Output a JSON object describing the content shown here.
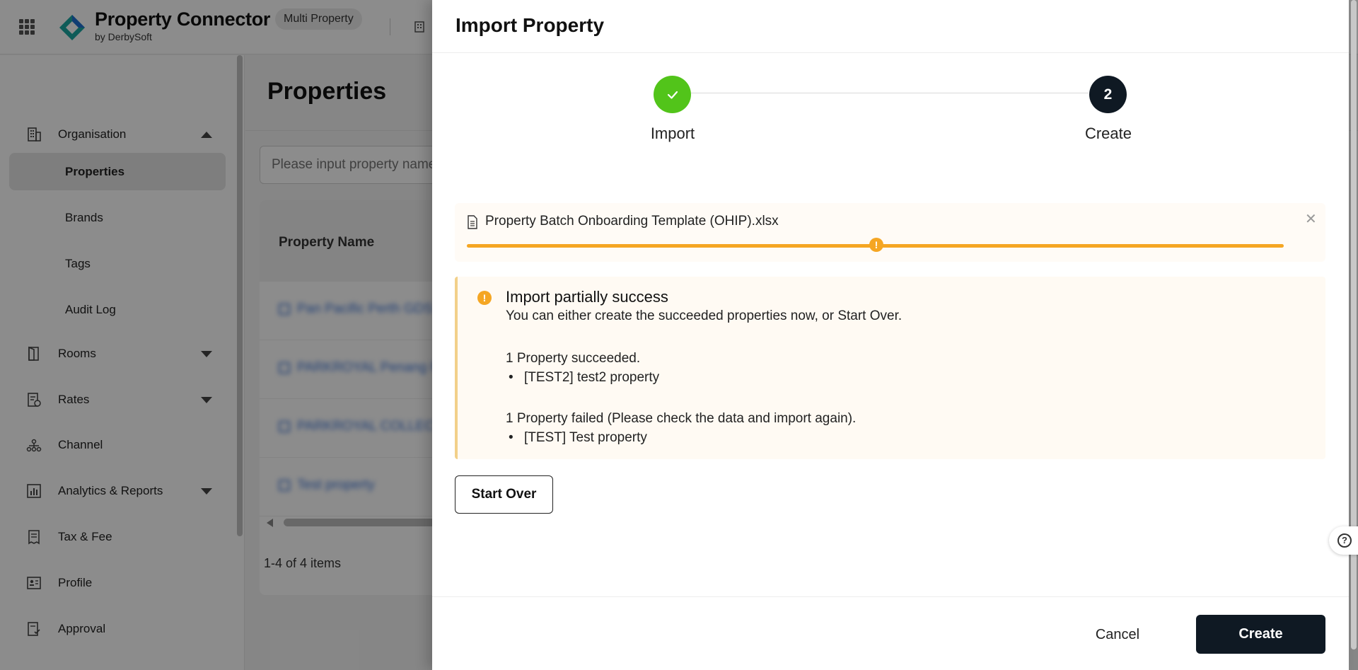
{
  "app": {
    "name": "Property Connector",
    "vendor": "by DerbySoft",
    "mode_badge": "Multi Property",
    "brand_colors": {
      "logo_teal": "#1aa6a0",
      "logo_blue": "#1f6fd1"
    }
  },
  "sidebar": {
    "organisation": {
      "label": "Organisation",
      "icon": "building-icon",
      "expanded": true
    },
    "sub_items": [
      {
        "label": "Properties",
        "active": true
      },
      {
        "label": "Brands",
        "active": false
      },
      {
        "label": "Tags",
        "active": false
      },
      {
        "label": "Audit Log",
        "active": false
      }
    ],
    "items": [
      {
        "label": "Rooms",
        "icon": "door-icon",
        "has_submenu": true
      },
      {
        "label": "Rates",
        "icon": "rate-sheet-icon",
        "has_submenu": true
      },
      {
        "label": "Channel",
        "icon": "network-icon",
        "has_submenu": false
      },
      {
        "label": "Analytics & Reports",
        "icon": "chart-icon",
        "has_submenu": true
      },
      {
        "label": "Tax & Fee",
        "icon": "receipt-icon",
        "has_submenu": false
      },
      {
        "label": "Profile",
        "icon": "profile-card-icon",
        "has_submenu": false
      },
      {
        "label": "Approval",
        "icon": "approval-icon",
        "has_submenu": false
      }
    ]
  },
  "main": {
    "title": "Properties",
    "search": {
      "placeholder": "Please input property name",
      "value": ""
    },
    "table": {
      "column_header": "Property Name",
      "rows": [
        {
          "name": "Pan Pacific Perth GDS"
        },
        {
          "name": "PARKROYAL Penang Resort"
        },
        {
          "name": "PARKROYAL COLLECTION"
        },
        {
          "name": "Test property"
        }
      ],
      "pagination": "1-4 of 4 items"
    }
  },
  "drawer": {
    "title": "Import Property",
    "steps": [
      {
        "label": "Import",
        "status": "done"
      },
      {
        "label": "Create",
        "number": "2",
        "status": "current"
      }
    ],
    "file": {
      "name": "Property Batch Onboarding Template (OHIP).xlsx",
      "progress": 1.0,
      "status": "warning",
      "status_color": "#f5a623"
    },
    "alert": {
      "title": "Import partially success",
      "description": "You can either create the succeeded properties now, or Start Over.",
      "succeeded_heading": "1 Property succeeded.",
      "succeeded_items": [
        "[TEST2] test2 property"
      ],
      "failed_heading": "1 Property failed (Please check the data and import again).",
      "failed_items": [
        "[TEST] Test property"
      ]
    },
    "start_over_label": "Start Over",
    "cancel_label": "Cancel",
    "create_label": "Create",
    "help_icon": "?"
  }
}
